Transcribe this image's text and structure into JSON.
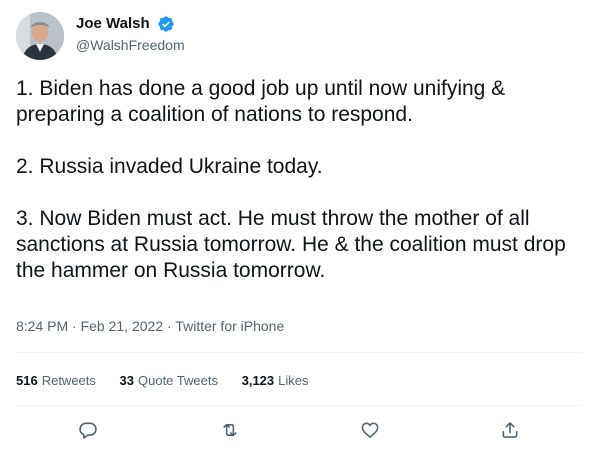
{
  "user": {
    "display_name": "Joe Walsh",
    "handle": "@WalshFreedom",
    "verified": true
  },
  "tweet": {
    "paragraphs": [
      "1. Biden has done a good job up until now unifying & preparing a coalition of nations to respond.",
      "2. Russia invaded Ukraine today.",
      "3. Now Biden must act. He must throw the mother of all sanctions at Russia tomorrow. He & the coalition must drop the hammer on Russia tomorrow."
    ],
    "time": "8:24 PM",
    "date": "Feb 21, 2022",
    "source": "Twitter for iPhone",
    "separator": "·"
  },
  "stats": {
    "retweets_count": "516",
    "retweets_label": "Retweets",
    "quotes_count": "33",
    "quotes_label": "Quote Tweets",
    "likes_count": "3,123",
    "likes_label": "Likes"
  },
  "actions": [
    {
      "icon": "reply-icon"
    },
    {
      "icon": "retweet-icon"
    },
    {
      "icon": "like-icon"
    },
    {
      "icon": "share-icon"
    }
  ],
  "colors": {
    "text": "#0f1419",
    "secondary": "#536471",
    "verified": "#1d9bf0",
    "divider": "#eff3f4"
  }
}
